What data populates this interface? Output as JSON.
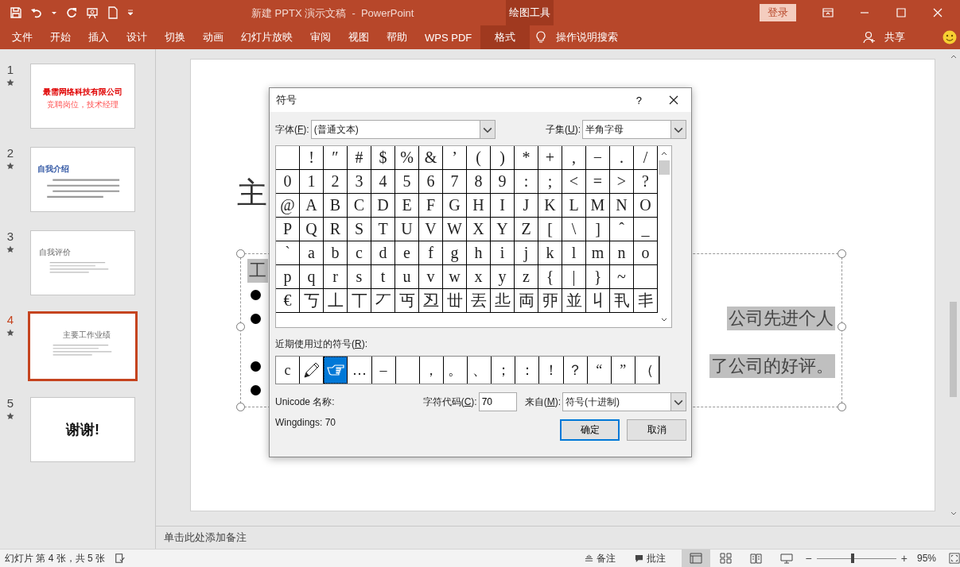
{
  "window": {
    "title": "新建 PPTX 演示文稿  -  PowerPoint",
    "context_group": "绘图工具",
    "login": "登录"
  },
  "ribbon_tabs": [
    {
      "label": "文件",
      "selected": false
    },
    {
      "label": "开始",
      "selected": false
    },
    {
      "label": "插入",
      "selected": false
    },
    {
      "label": "设计",
      "selected": false
    },
    {
      "label": "切换",
      "selected": false
    },
    {
      "label": "动画",
      "selected": false
    },
    {
      "label": "幻灯片放映",
      "selected": false
    },
    {
      "label": "审阅",
      "selected": false
    },
    {
      "label": "视图",
      "selected": false
    },
    {
      "label": "帮助",
      "selected": false
    },
    {
      "label": "WPS PDF",
      "selected": false
    },
    {
      "label": "格式",
      "selected": true
    }
  ],
  "tell_me": "操作说明搜索",
  "share": "共享",
  "slides": [
    {
      "number": "1",
      "selected": false,
      "kind": "title",
      "title": "最需网络科技有限公司",
      "subtitle": "竞聘岗位，技术经理"
    },
    {
      "number": "2",
      "selected": false,
      "kind": "text",
      "title": "自我介绍"
    },
    {
      "number": "3",
      "selected": false,
      "kind": "bullets",
      "title": "自我评价"
    },
    {
      "number": "4",
      "selected": true,
      "kind": "bullets",
      "title": "主要工作业绩"
    },
    {
      "number": "5",
      "selected": false,
      "kind": "closing",
      "title": "谢谢!"
    }
  ],
  "slide": {
    "title": "主",
    "lines": [
      {
        "kind": "plain",
        "text": "工",
        "highlight": true
      },
      {
        "kind": "bullet"
      },
      {
        "kind": "bullet",
        "text": "公司先进个人",
        "highlight": true
      },
      {
        "kind": "continuation"
      },
      {
        "kind": "bullet",
        "text": "了公司的好评。",
        "highlight": true
      },
      {
        "kind": "bullet"
      }
    ]
  },
  "notes_placeholder": "单击此处添加备注",
  "dialog": {
    "title": "符号",
    "help": "?",
    "font": {
      "label": {
        "before": "字体(",
        "key": "F",
        "after": "):"
      },
      "value": "(普通文本)"
    },
    "subset": {
      "label": {
        "before": "子集(",
        "key": "U",
        "after": "):"
      },
      "value": "半角字母"
    },
    "grid": [
      [
        {
          "kind": "blank"
        },
        {
          "kind": "char",
          "char": "!"
        },
        {
          "kind": "char",
          "char": "″"
        },
        {
          "kind": "char",
          "char": "#"
        },
        {
          "kind": "char",
          "char": "$"
        },
        {
          "kind": "char",
          "char": "%"
        },
        {
          "kind": "char",
          "char": "&"
        },
        {
          "kind": "char",
          "char": "’"
        },
        {
          "kind": "char",
          "char": "("
        },
        {
          "kind": "char",
          "char": ")"
        },
        {
          "kind": "char",
          "char": "*"
        },
        {
          "kind": "char",
          "char": "+"
        },
        {
          "kind": "char",
          "char": ","
        },
        {
          "kind": "char",
          "char": "−"
        },
        {
          "kind": "char",
          "char": "."
        },
        {
          "kind": "char",
          "char": "/"
        }
      ],
      [
        {
          "kind": "char",
          "char": "0"
        },
        {
          "kind": "char",
          "char": "1"
        },
        {
          "kind": "char",
          "char": "2"
        },
        {
          "kind": "char",
          "char": "3"
        },
        {
          "kind": "char",
          "char": "4"
        },
        {
          "kind": "char",
          "char": "5"
        },
        {
          "kind": "char",
          "char": "6"
        },
        {
          "kind": "char",
          "char": "7"
        },
        {
          "kind": "char",
          "char": "8"
        },
        {
          "kind": "char",
          "char": "9"
        },
        {
          "kind": "char",
          "char": ":"
        },
        {
          "kind": "char",
          "char": ";"
        },
        {
          "kind": "char",
          "char": "<"
        },
        {
          "kind": "char",
          "char": "="
        },
        {
          "kind": "char",
          "char": ">"
        },
        {
          "kind": "char",
          "char": "?"
        }
      ],
      [
        {
          "kind": "char",
          "char": "@"
        },
        {
          "kind": "char",
          "char": "A"
        },
        {
          "kind": "char",
          "char": "B"
        },
        {
          "kind": "char",
          "char": "C"
        },
        {
          "kind": "char",
          "char": "D"
        },
        {
          "kind": "char",
          "char": "E"
        },
        {
          "kind": "char",
          "char": "F"
        },
        {
          "kind": "char",
          "char": "G"
        },
        {
          "kind": "char",
          "char": "H"
        },
        {
          "kind": "char",
          "char": "I"
        },
        {
          "kind": "char",
          "char": "J"
        },
        {
          "kind": "char",
          "char": "K"
        },
        {
          "kind": "char",
          "char": "L"
        },
        {
          "kind": "char",
          "char": "M"
        },
        {
          "kind": "char",
          "char": "N"
        },
        {
          "kind": "char",
          "char": "O"
        }
      ],
      [
        {
          "kind": "char",
          "char": "P"
        },
        {
          "kind": "char",
          "char": "Q"
        },
        {
          "kind": "char",
          "char": "R"
        },
        {
          "kind": "char",
          "char": "S"
        },
        {
          "kind": "char",
          "char": "T"
        },
        {
          "kind": "char",
          "char": "U"
        },
        {
          "kind": "char",
          "char": "V"
        },
        {
          "kind": "char",
          "char": "W"
        },
        {
          "kind": "char",
          "char": "X"
        },
        {
          "kind": "char",
          "char": "Y"
        },
        {
          "kind": "char",
          "char": "Z"
        },
        {
          "kind": "char",
          "char": "["
        },
        {
          "kind": "char",
          "char": "\\"
        },
        {
          "kind": "char",
          "char": "]"
        },
        {
          "kind": "char",
          "char": "ˆ"
        },
        {
          "kind": "char",
          "char": "_"
        }
      ],
      [
        {
          "kind": "char",
          "char": "`"
        },
        {
          "kind": "char",
          "char": "a"
        },
        {
          "kind": "char",
          "char": "b"
        },
        {
          "kind": "char",
          "char": "c"
        },
        {
          "kind": "char",
          "char": "d"
        },
        {
          "kind": "char",
          "char": "e"
        },
        {
          "kind": "char",
          "char": "f"
        },
        {
          "kind": "char",
          "char": "g"
        },
        {
          "kind": "char",
          "char": "h"
        },
        {
          "kind": "char",
          "char": "i"
        },
        {
          "kind": "char",
          "char": "j"
        },
        {
          "kind": "char",
          "char": "k"
        },
        {
          "kind": "char",
          "char": "l"
        },
        {
          "kind": "char",
          "char": "m"
        },
        {
          "kind": "char",
          "char": "n"
        },
        {
          "kind": "char",
          "char": "o"
        }
      ],
      [
        {
          "kind": "char",
          "char": "p"
        },
        {
          "kind": "char",
          "char": "q"
        },
        {
          "kind": "char",
          "char": "r"
        },
        {
          "kind": "char",
          "char": "s"
        },
        {
          "kind": "char",
          "char": "t"
        },
        {
          "kind": "char",
          "char": "u"
        },
        {
          "kind": "char",
          "char": "v"
        },
        {
          "kind": "char",
          "char": "w"
        },
        {
          "kind": "char",
          "char": "x"
        },
        {
          "kind": "char",
          "char": "y"
        },
        {
          "kind": "char",
          "char": "z"
        },
        {
          "kind": "char",
          "char": "{"
        },
        {
          "kind": "char",
          "char": "|"
        },
        {
          "kind": "char",
          "char": "}"
        },
        {
          "kind": "char",
          "char": "~"
        },
        {
          "kind": "blank"
        }
      ],
      [
        {
          "kind": "char",
          "char": "€"
        },
        {
          "kind": "char",
          "char": "丂"
        },
        {
          "kind": "char",
          "char": "丄"
        },
        {
          "kind": "char",
          "char": "丅"
        },
        {
          "kind": "char",
          "char": "丆"
        },
        {
          "kind": "char",
          "char": "丏"
        },
        {
          "kind": "char",
          "char": "丒"
        },
        {
          "kind": "char",
          "char": "丗"
        },
        {
          "kind": "char",
          "char": "丟"
        },
        {
          "kind": "char",
          "char": "丠"
        },
        {
          "kind": "char",
          "char": "両"
        },
        {
          "kind": "char",
          "char": "丣"
        },
        {
          "kind": "char",
          "char": "並"
        },
        {
          "kind": "char",
          "char": "丩"
        },
        {
          "kind": "char",
          "char": "丮"
        },
        {
          "kind": "char",
          "char": "丯"
        }
      ]
    ],
    "recent_label": {
      "before": "近期使用过的符号(",
      "key": "R",
      "after": "):"
    },
    "recent": [
      {
        "kind": "char",
        "char": "c",
        "selected": false
      },
      {
        "kind": "pencil",
        "selected": false
      },
      {
        "kind": "pointing-hand",
        "selected": true
      },
      {
        "kind": "char",
        "char": "…",
        "selected": false
      },
      {
        "kind": "char",
        "char": "–",
        "selected": false
      },
      {
        "kind": "blank",
        "selected": false
      },
      {
        "kind": "char",
        "char": "，",
        "selected": false
      },
      {
        "kind": "char",
        "char": "。",
        "selected": false
      },
      {
        "kind": "char",
        "char": "、",
        "selected": false
      },
      {
        "kind": "char",
        "char": "；",
        "selected": false
      },
      {
        "kind": "char",
        "char": "：",
        "selected": false
      },
      {
        "kind": "char",
        "char": "！",
        "selected": false
      },
      {
        "kind": "char",
        "char": "？",
        "selected": false
      },
      {
        "kind": "char",
        "char": "“",
        "selected": false
      },
      {
        "kind": "char",
        "char": "”",
        "selected": false
      },
      {
        "kind": "char",
        "char": "（",
        "selected": false
      }
    ],
    "unicode_name_label": "Unicode 名称:",
    "char_name": "Wingdings: 70",
    "code": {
      "label": {
        "before": "字符代码(",
        "key": "C",
        "after": "):"
      },
      "value": "70"
    },
    "from": {
      "label": {
        "before": "来自(",
        "key": "M",
        "after": "):"
      },
      "value": "符号(十进制)"
    },
    "ok": "确定",
    "cancel": "取消"
  },
  "status": {
    "slide_info": "幻灯片 第 4 张，共 5 张",
    "notes": "备注",
    "comments": "批注",
    "views": [
      {
        "kind": "normal",
        "selected": true
      },
      {
        "kind": "sorter",
        "selected": false
      },
      {
        "kind": "reading",
        "selected": false
      },
      {
        "kind": "show",
        "selected": false
      }
    ],
    "zoom_minus": "−",
    "zoom_plus": "+",
    "zoom": {
      "level": 0.45
    },
    "zoom_text": "95%"
  }
}
